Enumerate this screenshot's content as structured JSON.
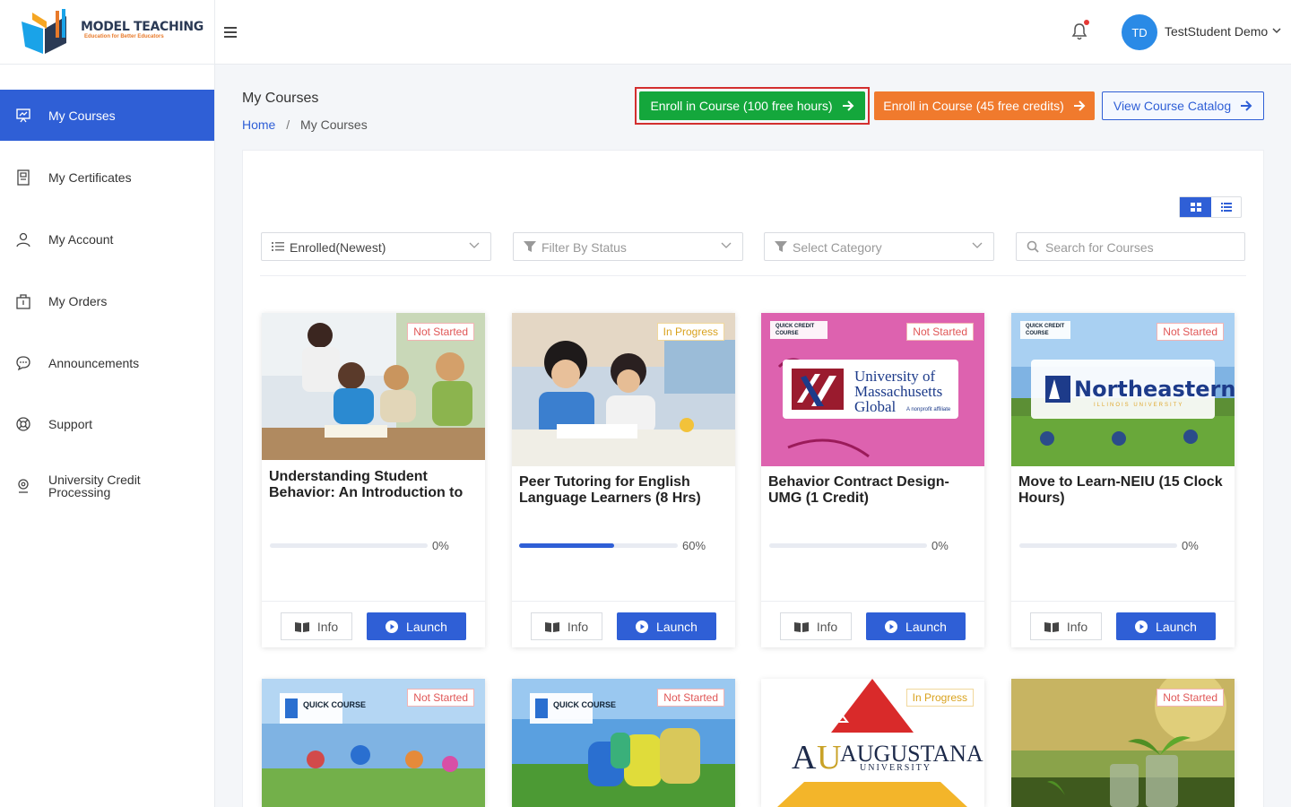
{
  "brand": {
    "name": "MODEL TEACHING",
    "tagline": "Education for Better Educators"
  },
  "user": {
    "initials": "TD",
    "name": "TestStudent Demo"
  },
  "sidebar": {
    "items": [
      {
        "label": "My Courses"
      },
      {
        "label": "My Certificates"
      },
      {
        "label": "My Account"
      },
      {
        "label": "My Orders"
      },
      {
        "label": "Announcements"
      },
      {
        "label": "Support"
      },
      {
        "label": "University Credit Processing"
      }
    ]
  },
  "page": {
    "title": "My Courses"
  },
  "breadcrumb": {
    "home": "Home",
    "sep": "/",
    "current": "My Courses"
  },
  "actions": {
    "enroll_hours": "Enroll in Course (100 free hours)",
    "enroll_credits": "Enroll in Course (45 free credits)",
    "catalog": "View Course Catalog"
  },
  "filters": {
    "sort": "Enrolled(Newest)",
    "status_placeholder": "Filter By Status",
    "category_placeholder": "Select Category",
    "search_placeholder": "Search for Courses"
  },
  "card_labels": {
    "info": "Info",
    "launch": "Launch"
  },
  "courses": [
    {
      "title": "Understanding Student Behavior: An Introduction to th...",
      "status": "Not Started",
      "progress": 0,
      "progress_label": "0%"
    },
    {
      "title": "Peer Tutoring for English Language Learners (8 Hrs)",
      "status": "In Progress",
      "progress": 60,
      "progress_label": "60%"
    },
    {
      "title": "Behavior Contract Design-UMG (1 Credit)",
      "status": "Not Started",
      "progress": 0,
      "progress_label": "0%",
      "image_text": {
        "badge": "QUICK CREDIT COURSE",
        "university_line1": "University of",
        "university_line2": "Massachusetts",
        "university_line3": "Global",
        "affiliate": "A nonprofit affiliate"
      }
    },
    {
      "title": "Move to Learn-NEIU (15 Clock Hours)",
      "status": "Not Started",
      "progress": 0,
      "progress_label": "0%",
      "image_text": {
        "badge": "QUICK CREDIT COURSE",
        "university": "Northeastern",
        "university_sub": "ILLINOIS UNIVERSITY"
      }
    },
    {
      "status": "Not Started",
      "image_text": {
        "badge": "QUICK COURSE"
      }
    },
    {
      "status": "Not Started",
      "image_text": {
        "badge": "QUICK COURSE"
      }
    },
    {
      "status": "In Progress",
      "image_text": {
        "university": "AUGUSTANA",
        "university_sub": "UNIVERSITY"
      }
    },
    {
      "status": "Not Started"
    }
  ],
  "colors": {
    "primary": "#2f5fd6",
    "green": "#14a73c",
    "orange": "#f07a2d",
    "not_started": "#e05656",
    "in_progress": "#d9a21e"
  }
}
